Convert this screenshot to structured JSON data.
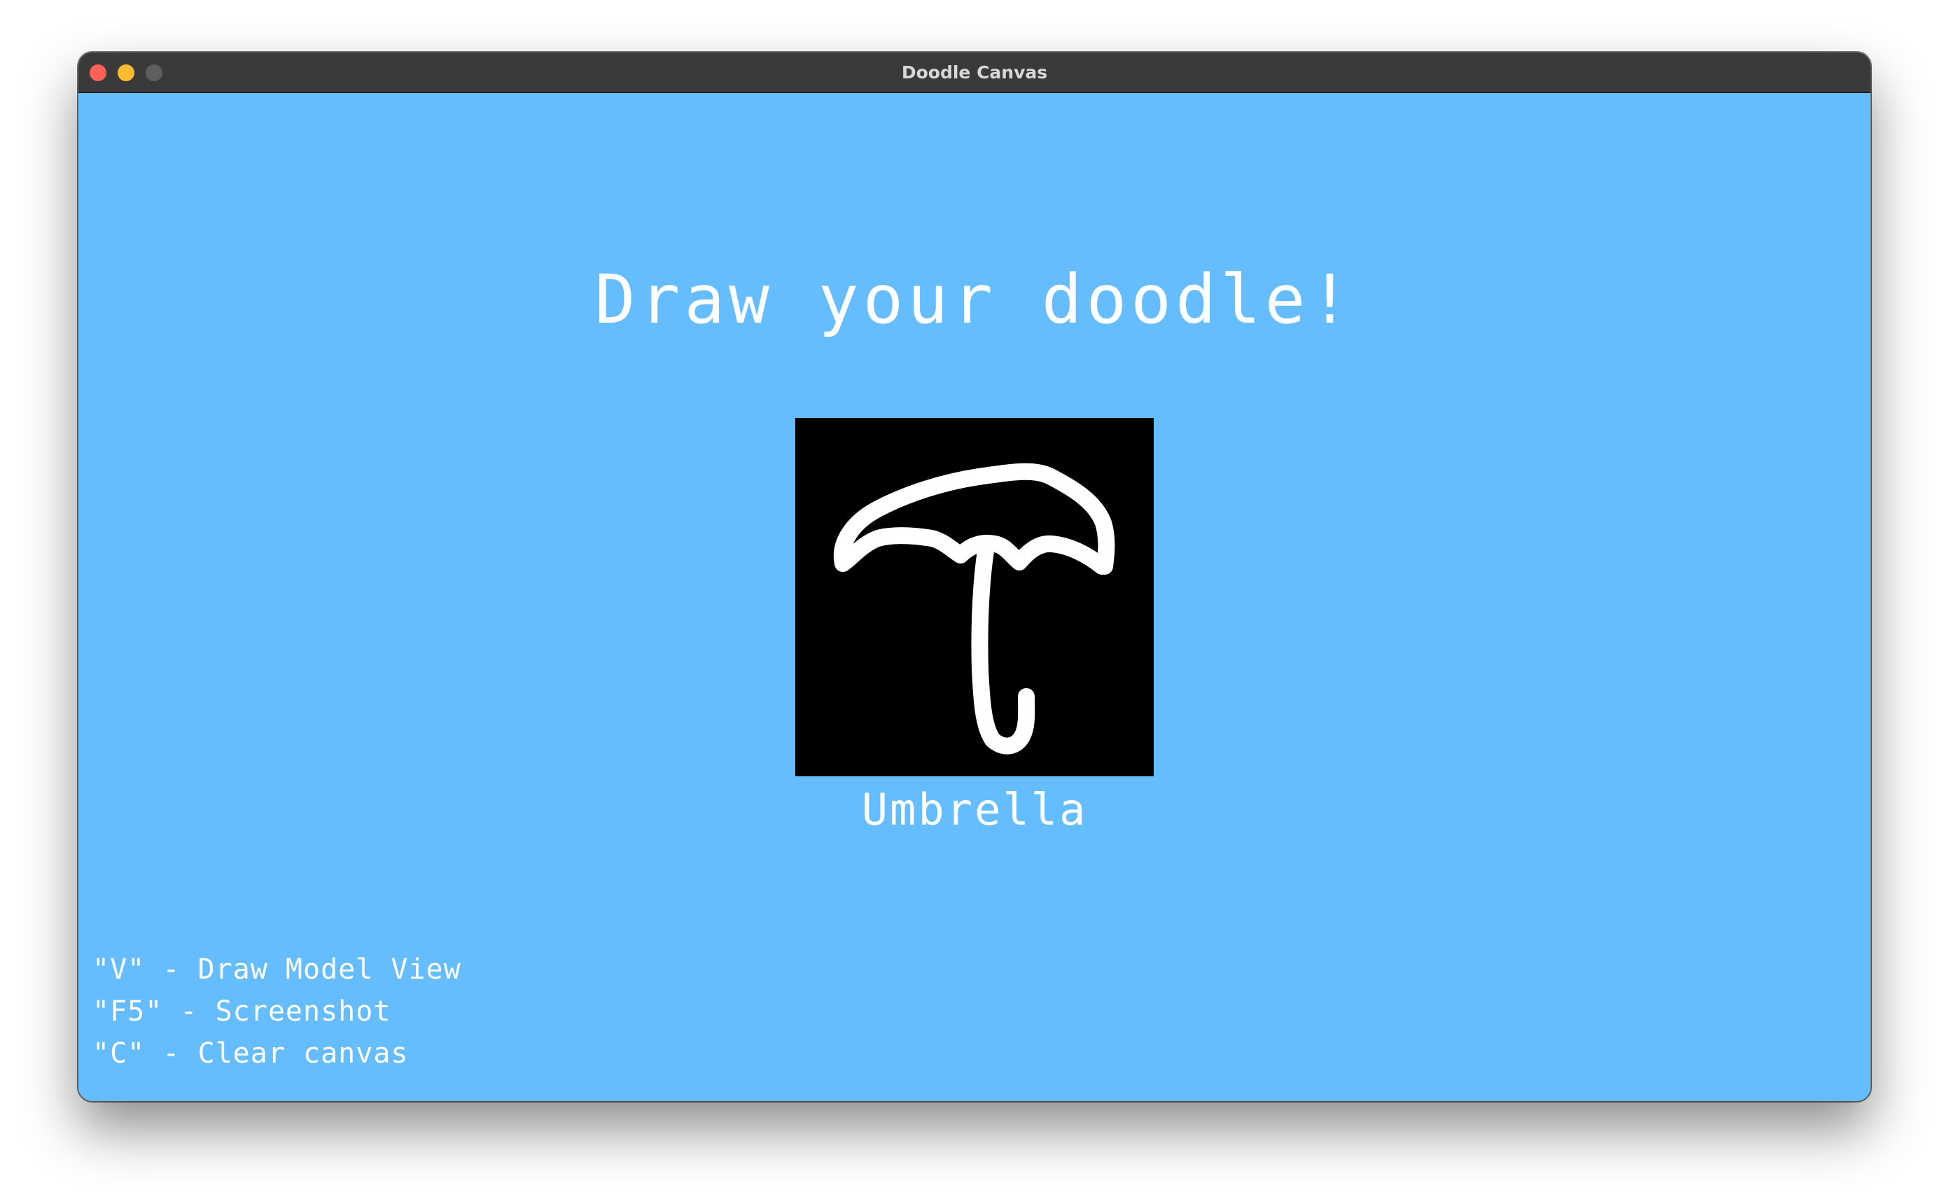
{
  "window": {
    "title": "Doodle Canvas"
  },
  "colors": {
    "background": "#66bdfd",
    "titlebar": "#3a3a3a",
    "canvas": "#000000",
    "stroke": "#ffffff",
    "close": "#fe5f57",
    "minimize": "#febc2e",
    "zoom_disabled": "#5e5e5e"
  },
  "main": {
    "heading": "Draw your doodle!",
    "prediction": "Umbrella",
    "drawing_icon": "umbrella-doodle"
  },
  "shortcuts": [
    {
      "text": "\"V\" - Draw Model View"
    },
    {
      "text": "\"F5\" - Screenshot"
    },
    {
      "text": "\"C\" - Clear canvas"
    }
  ]
}
